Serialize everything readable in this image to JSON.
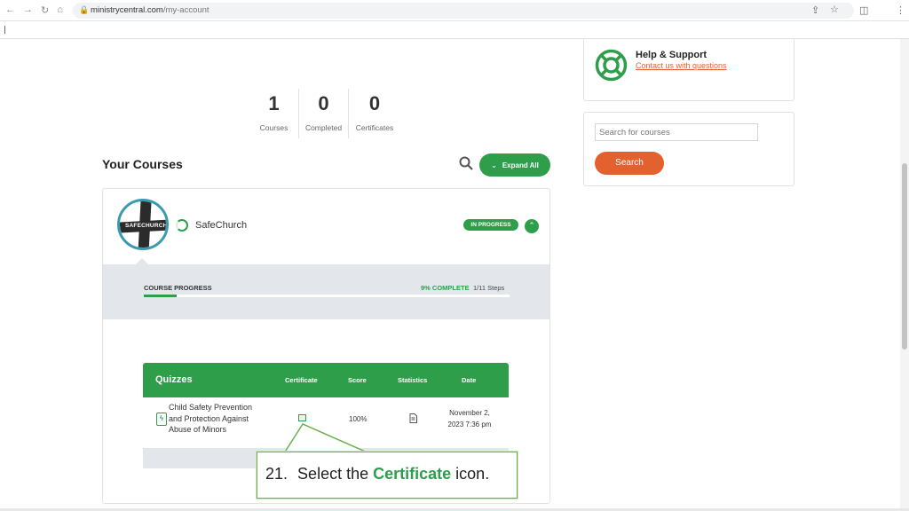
{
  "browser": {
    "url_domain": "ministrycentral.com",
    "url_path": "/my-account",
    "bookmarks_marker": "|"
  },
  "stats": [
    {
      "value": "1",
      "label": "Courses"
    },
    {
      "value": "0",
      "label": "Completed"
    },
    {
      "value": "0",
      "label": "Certificates"
    }
  ],
  "courses": {
    "heading": "Your Courses",
    "expand_label": "Expand All",
    "course": {
      "logo_text": "SAFECHURCH",
      "name": "SafeChurch",
      "status": "IN PROGRESS",
      "progress_label": "COURSE PROGRESS",
      "progress_pct_text": "9% COMPLETE",
      "progress_fraction": 0.09,
      "steps": "1/11 Steps"
    }
  },
  "quizzes": {
    "header": {
      "title": "Quizzes",
      "certificate": "Certificate",
      "score": "Score",
      "statistics": "Statistics",
      "date": "Date"
    },
    "row": {
      "title": "Child Safety Prevention and Protection Against Abuse of Minors",
      "score": "100%",
      "date": "November 2, 2023 7:36 pm"
    }
  },
  "sidebar": {
    "help_title": "Help & Support",
    "help_link": "Contact us with questions",
    "search_placeholder": "Search for courses",
    "search_button": "Search"
  },
  "callout": {
    "step": "21.",
    "prefix": "Select the",
    "highlight": "Certificate",
    "suffix": "icon."
  },
  "colors": {
    "brand_green": "#2e9e4a",
    "accent_orange": "#e3602f",
    "panel_gray": "#e3e7ec"
  }
}
